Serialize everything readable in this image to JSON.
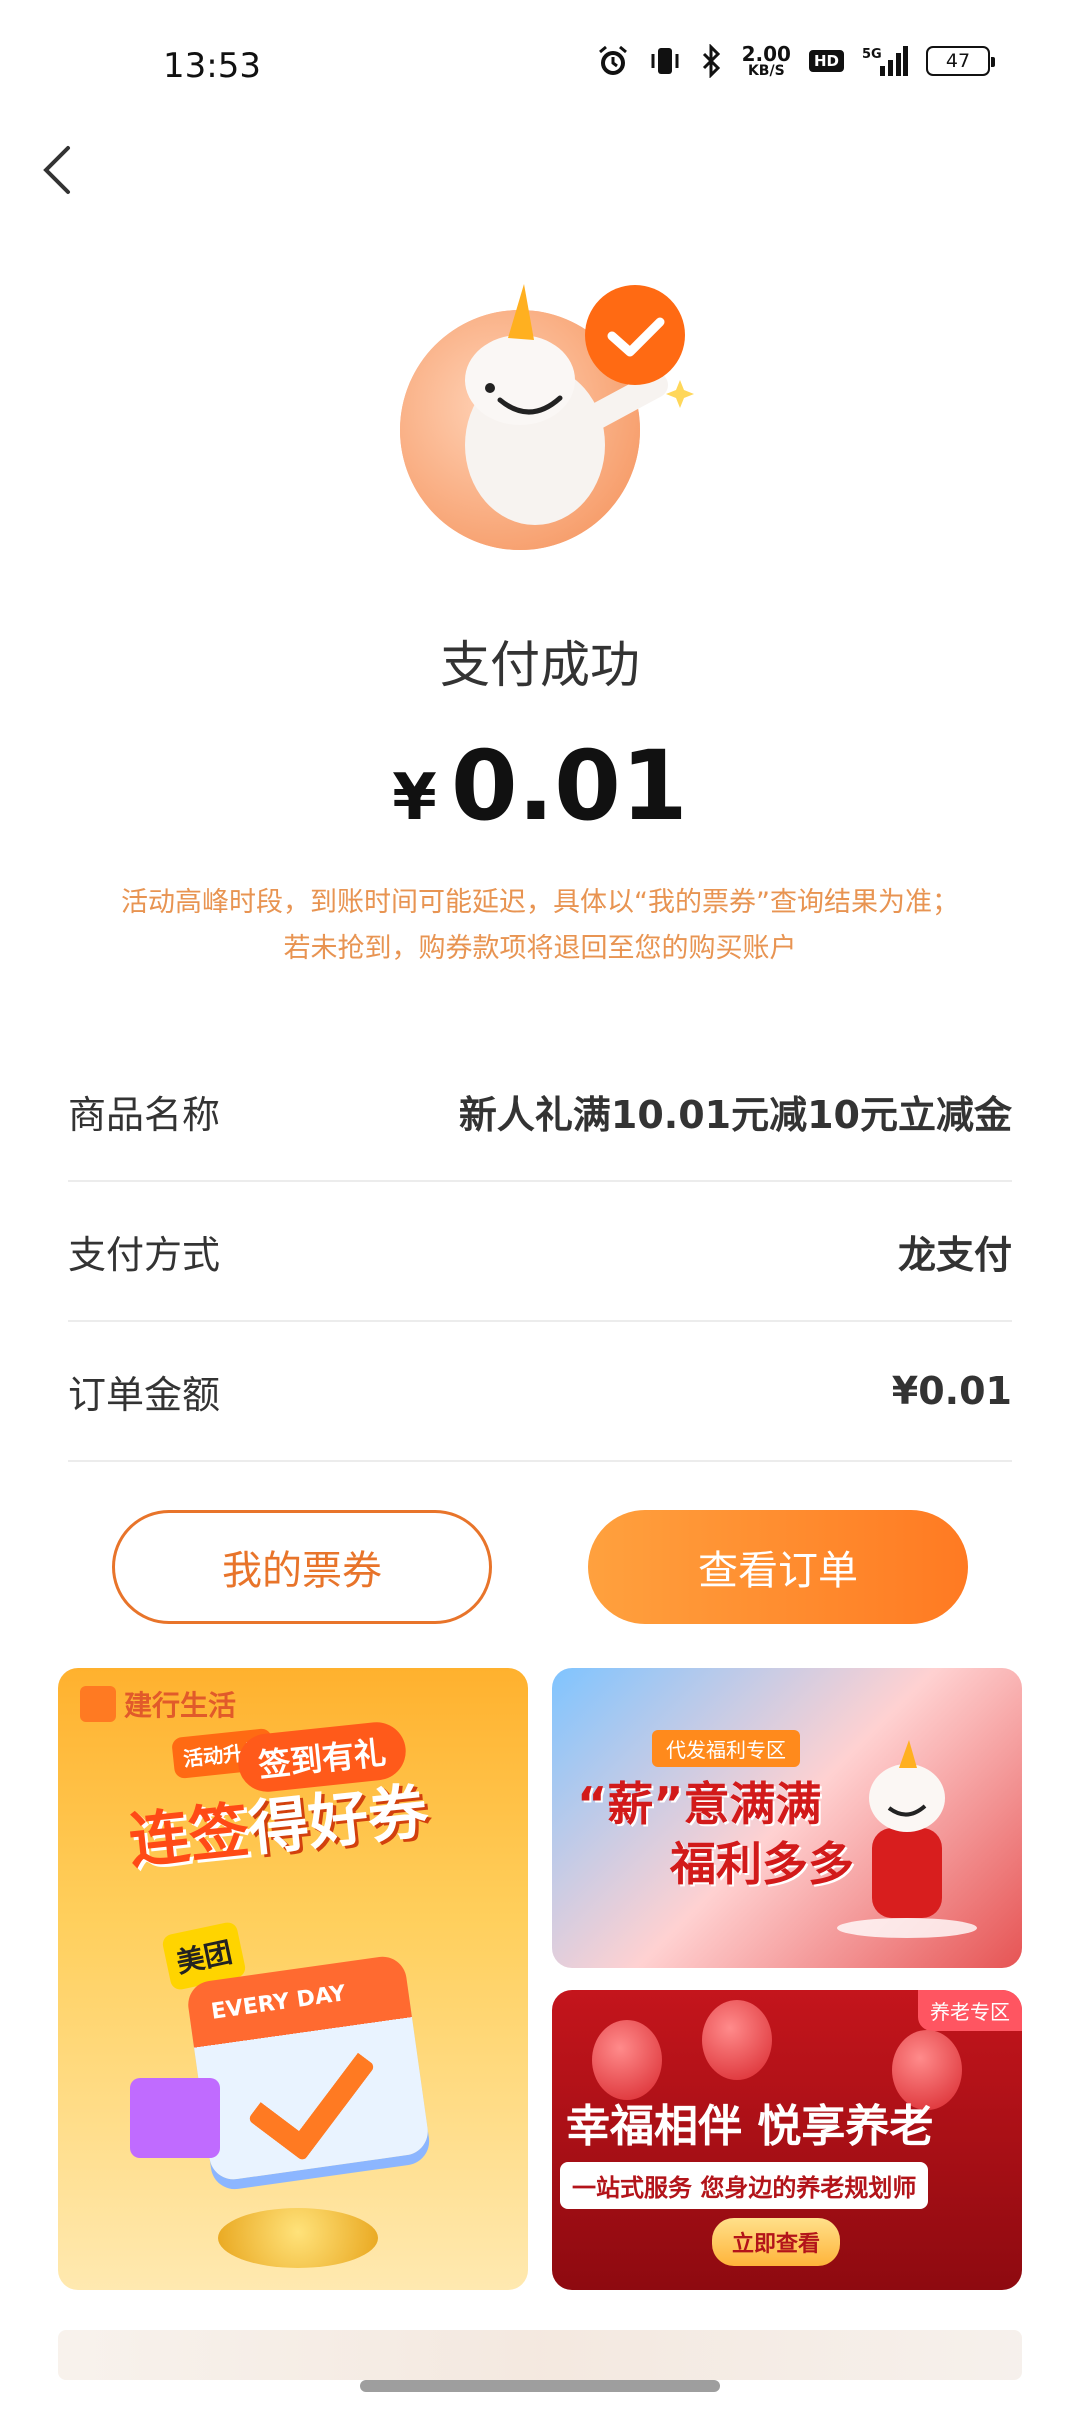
{
  "status_bar": {
    "time": "13:53",
    "network_speed": "2.00",
    "network_speed_unit": "KB/S",
    "hd_label": "HD",
    "signal_label": "5G",
    "battery": "47"
  },
  "result": {
    "title": "支付成功",
    "currency": "¥",
    "amount": "0.01",
    "notice_line1": "活动高峰时段，到账时间可能延迟，具体以“我的票券”查询结果为准；",
    "notice_line2": "若未抢到，购券款项将退回至您的购买账户"
  },
  "info": [
    {
      "label": "商品名称",
      "value": "新人礼满10.01元减10元立减金"
    },
    {
      "label": "支付方式",
      "value": "龙支付"
    },
    {
      "label": "订单金额",
      "value": "¥0.01"
    }
  ],
  "buttons": {
    "my_tickets": "我的票券",
    "view_order": "查看订单"
  },
  "banners": {
    "left": {
      "brand": "建行生活",
      "tag_upgrade": "活动升级",
      "sign_pill": "签到有礼",
      "slogan_highlight": "连签",
      "slogan_rest": "得好券",
      "calendar_text": "EVERY DAY",
      "meituan": "美团"
    },
    "right_top": {
      "tag": "代发福利专区",
      "line1": "“薪”意满满",
      "line2": "福利多多"
    },
    "right_bottom": {
      "corner": "养老专区",
      "title": "幸福相伴 悦享养老",
      "subtitle": "一站式服务 您身边的养老规划师",
      "cta": "立即查看"
    }
  },
  "colors": {
    "accent": "#ff7a22",
    "notice": "#e89452"
  }
}
